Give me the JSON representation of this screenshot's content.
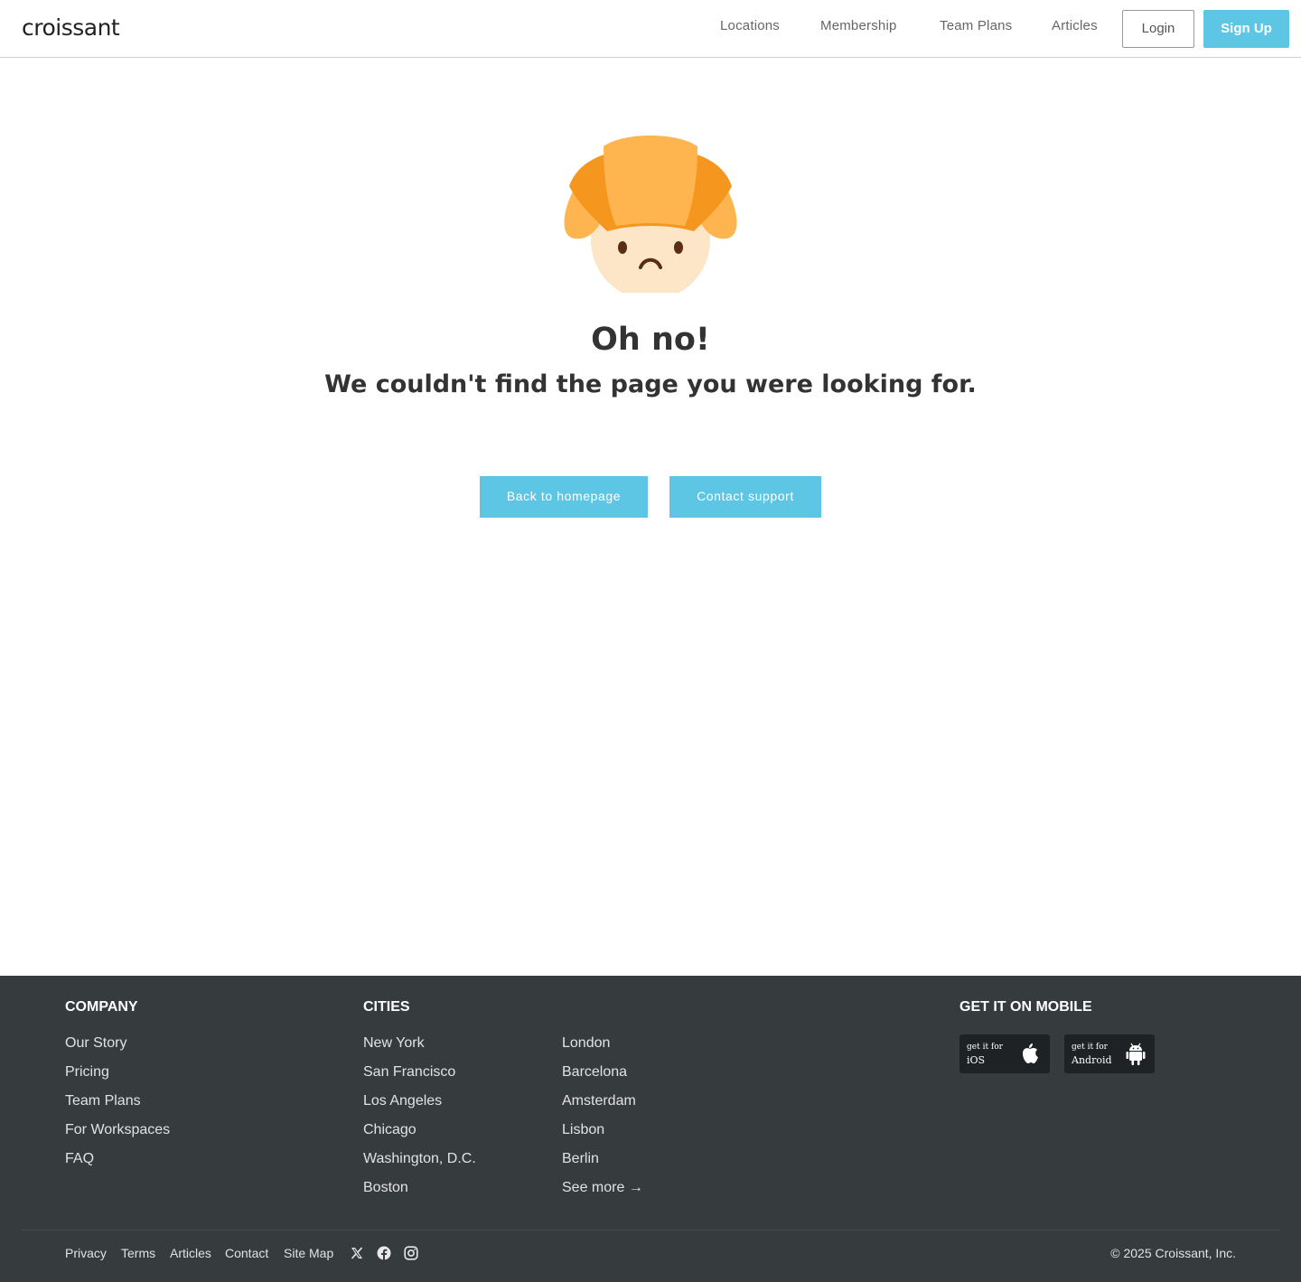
{
  "header": {
    "logo": "croissant",
    "nav": [
      "Locations",
      "Membership",
      "Team Plans",
      "Articles"
    ],
    "login_label": "Login",
    "signup_label": "Sign Up"
  },
  "main": {
    "title": "Oh no!",
    "subtitle": "We couldn't find the page you were looking for.",
    "primary_button": "Back to homepage",
    "secondary_button": "Contact support",
    "mascot_icon": "sad-croissant-icon"
  },
  "footer": {
    "company": {
      "heading": "COMPANY",
      "items": [
        "Our Story",
        "Pricing",
        "Team Plans",
        "For Workspaces",
        "FAQ"
      ]
    },
    "cities": {
      "heading": "CITIES",
      "column1": [
        "New York",
        "San Francisco",
        "Los Angeles",
        "Chicago",
        "Washington, D.C.",
        "Boston"
      ],
      "column2": [
        "London",
        "Barcelona",
        "Amsterdam",
        "Lisbon",
        "Berlin",
        "See more →"
      ]
    },
    "mobile": {
      "heading": "GET IT ON MOBILE",
      "ios": {
        "small": "get it for",
        "big": "iOS",
        "icon": "apple-icon"
      },
      "android": {
        "small": "get it for",
        "big": "Android",
        "icon": "android-icon"
      }
    },
    "bottom_links": [
      "Privacy",
      "Terms",
      "Articles",
      "Contact",
      "Site Map"
    ],
    "social_icons": [
      "x-icon",
      "facebook-icon",
      "instagram-icon"
    ],
    "copyright": "© 2025 Croissant, Inc."
  },
  "colors": {
    "accent": "#5dc6e4",
    "footer_bg": "#363b3e",
    "croissant_light": "#ffb54f",
    "croissant_dark": "#f5961f",
    "face": "#fde6c8"
  }
}
